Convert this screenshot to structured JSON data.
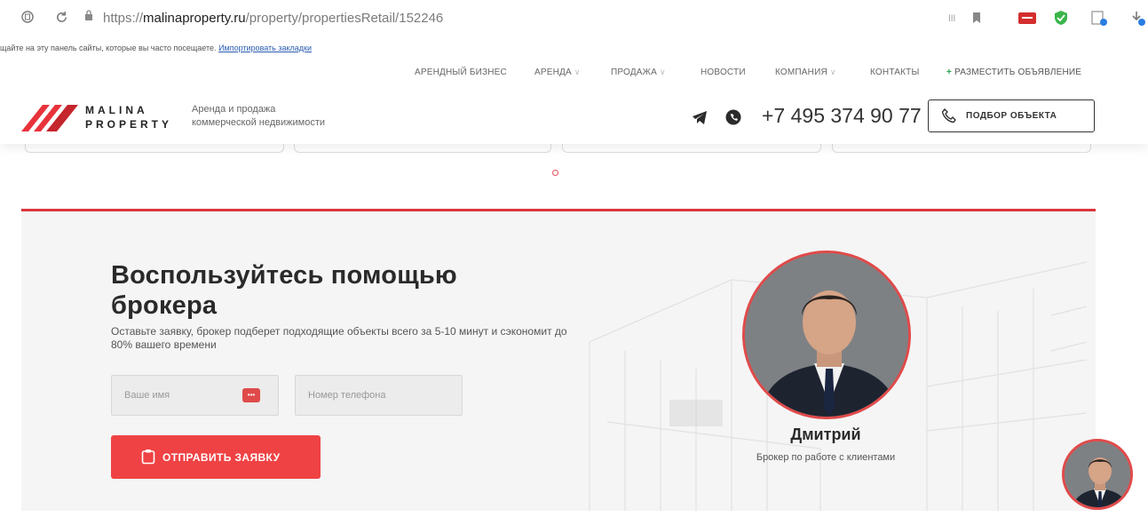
{
  "browser": {
    "url_scheme": "https://",
    "url_domain": "malinaproperty.ru",
    "url_path": "/property/propertiesRetail/152246",
    "bookmarks_hint": "щайте на эту панель сайты, которые вы часто посещаете.",
    "bookmarks_import": "Импортировать закладки"
  },
  "topnav": {
    "items": [
      {
        "label": "АРЕНДНЫЙ БИЗНЕС",
        "has_menu": false
      },
      {
        "label": "АРЕНДА",
        "has_menu": true
      },
      {
        "label": "ПРОДАЖА",
        "has_menu": true
      },
      {
        "label": "НОВОСТИ",
        "has_menu": false
      },
      {
        "label": "КОМПАНИЯ",
        "has_menu": true
      },
      {
        "label": "КОНТАКТЫ",
        "has_menu": false
      }
    ],
    "post_ad": "РАЗМЕСТИТЬ ОБЪЯВЛЕНИЕ",
    "post_ad_icon": "+"
  },
  "header": {
    "logo_line1": "MALINA",
    "logo_line2": "PROPERTY",
    "tagline_line1": "Аренда и продажа",
    "tagline_line2": "коммерческой недвижимости",
    "phone": "+7 495 374 90 77",
    "pick_button": "ПОДБОР ОБЪЕКТА",
    "icons": [
      "telegram-icon",
      "whatsapp-icon",
      "phone-icon"
    ]
  },
  "broker_section": {
    "title_line1": "Воспользуйтесь помощью",
    "title_line2": "брокера",
    "description": "Оставьте заявку, брокер подберет подходящие объекты всего за 5-10 минут и сэкономит до 80% вашего времени",
    "name_placeholder": "Ваше имя",
    "phone_placeholder": "Номер телефона",
    "password_manager_icon": "•••",
    "submit_label": "ОТПРАВИТЬ ЗАЯВКУ",
    "broker_name": "Дмитрий",
    "broker_role": "Брокер по работе с клиентами"
  },
  "colors": {
    "brand_red": "#ef4244",
    "accent_line": "#d9363e",
    "text_dark": "#2a2a2a"
  }
}
